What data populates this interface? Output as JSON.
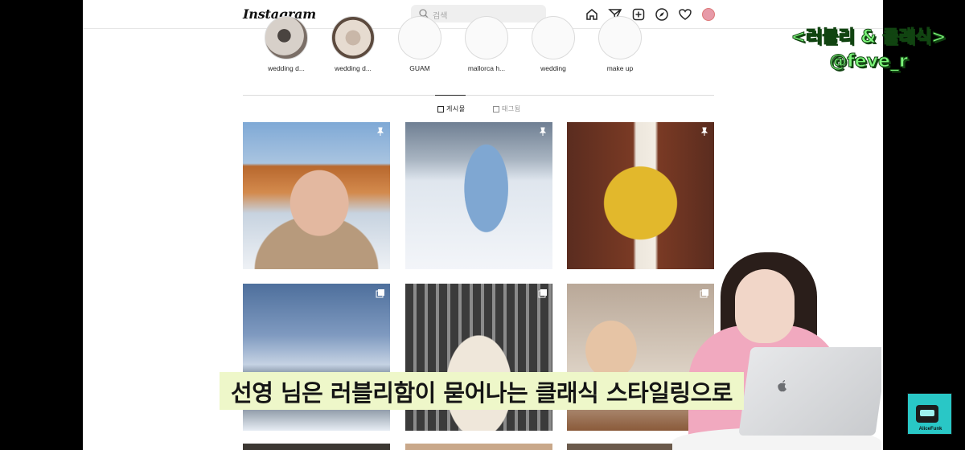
{
  "header": {
    "logo": "Instagram",
    "search_placeholder": "검색",
    "icons": [
      "home-icon",
      "send-icon",
      "new-post-icon",
      "explore-icon",
      "heart-icon",
      "profile-avatar"
    ]
  },
  "highlights": [
    {
      "label": "wedding d..."
    },
    {
      "label": "wedding d..."
    },
    {
      "label": "GUAM"
    },
    {
      "label": "mallorca h..."
    },
    {
      "label": "wedding"
    },
    {
      "label": "make up"
    }
  ],
  "tabs": [
    {
      "label": "게시물",
      "active": true
    },
    {
      "label": "태그됨",
      "active": false
    }
  ],
  "overlay": {
    "title_line1": "<러블리 & 클래식>",
    "title_line2": "@feve_r",
    "subtitle": "선영 님은 러블리함이 묻어나는 클래식 스타일링으로",
    "channel": "AliceFunk"
  },
  "colors": {
    "title_green": "#7cf57a",
    "subtitle_bg": "#eef7c9"
  }
}
